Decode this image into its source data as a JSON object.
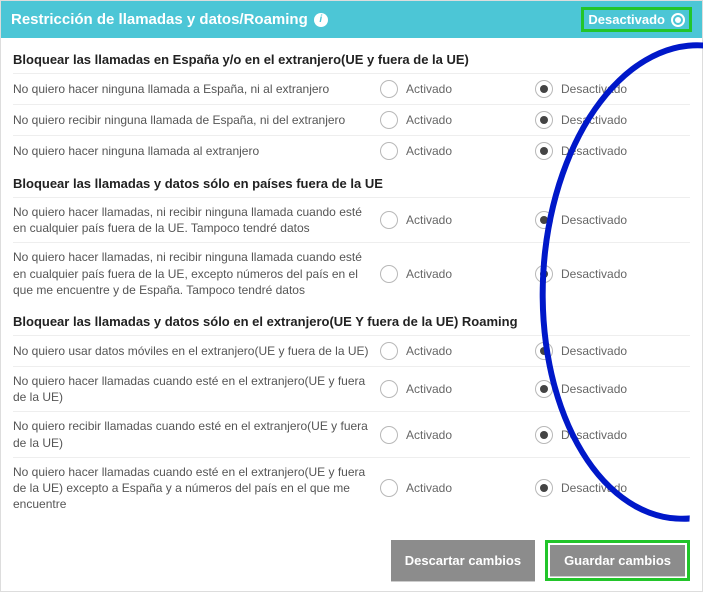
{
  "header": {
    "title": "Restricción de llamadas y datos/Roaming",
    "status_label": "Desactivado"
  },
  "labels": {
    "activado": "Activado",
    "desactivado": "Desactivado"
  },
  "sections": [
    {
      "title": "Bloquear las llamadas en España y/o en el extranjero(UE y fuera de la UE)",
      "rows": [
        {
          "desc": "No quiero hacer ninguna llamada a España, ni al extranjero",
          "value": "desactivado"
        },
        {
          "desc": "No quiero recibir ninguna llamada de España, ni del extranjero",
          "value": "desactivado"
        },
        {
          "desc": "No quiero hacer ninguna llamada al extranjero",
          "value": "desactivado"
        }
      ]
    },
    {
      "title": "Bloquear las llamadas y datos sólo en países fuera de la UE",
      "rows": [
        {
          "desc": "No quiero hacer llamadas, ni recibir ninguna llamada cuando esté en cualquier país fuera de la UE. Tampoco tendré datos",
          "value": "desactivado"
        },
        {
          "desc": "No quiero hacer llamadas, ni recibir ninguna llamada cuando esté en cualquier país fuera de la UE, excepto números del país en el que me encuentre y de España. Tampoco tendré datos",
          "value": "desactivado"
        }
      ]
    },
    {
      "title": "Bloquear las llamadas y datos sólo en el extranjero(UE Y fuera de la UE) Roaming",
      "rows": [
        {
          "desc": "No quiero usar datos móviles en el extranjero(UE y fuera de la UE)",
          "value": "desactivado"
        },
        {
          "desc": "No quiero hacer llamadas cuando esté en el extranjero(UE y fuera de la UE)",
          "value": "desactivado"
        },
        {
          "desc": "No quiero recibir llamadas cuando esté en el extranjero(UE y fuera de la UE)",
          "value": "desactivado"
        },
        {
          "desc": "No quiero hacer llamadas cuando esté en el extranjero(UE y fuera de la UE) excepto a España y a números del país en el que me encuentre",
          "value": "desactivado"
        }
      ]
    }
  ],
  "footer": {
    "discard": "Descartar cambios",
    "save": "Guardar cambios"
  }
}
